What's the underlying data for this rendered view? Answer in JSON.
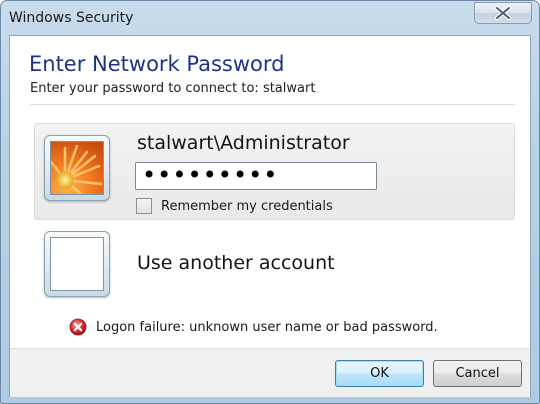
{
  "window": {
    "title": "Windows Security"
  },
  "dialog": {
    "heading": "Enter Network Password",
    "subheading": "Enter your password to connect to: stalwart"
  },
  "credential_tile": {
    "username": "stalwart\\Administrator",
    "password_masked": "•••••••••",
    "remember_label": "Remember my credentials",
    "remember_checked": false
  },
  "other_account": {
    "label": "Use another account"
  },
  "error": {
    "message": "Logon failure: unknown user name or bad password.",
    "icon": "error-icon"
  },
  "buttons": {
    "ok_label": "OK",
    "cancel_label": "Cancel"
  },
  "colors": {
    "heading": "#1e3287",
    "error_red": "#d92e2e",
    "default_button": "#3c7fb1"
  }
}
